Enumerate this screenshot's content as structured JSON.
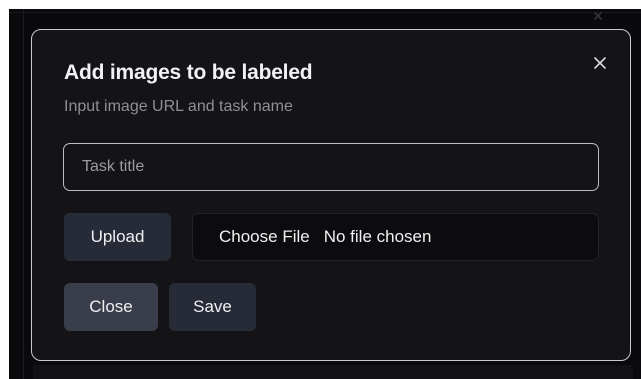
{
  "modal": {
    "title": "Add images to be labeled",
    "subtitle": "Input image URL and task name",
    "task_input": {
      "placeholder": "Task title",
      "value": ""
    },
    "upload_label": "Upload",
    "file_picker": {
      "button_label": "Choose File",
      "status": "No file chosen"
    },
    "close_label": "Close",
    "save_label": "Save",
    "close_icon": "close-icon"
  },
  "background": {
    "close_icon": "close-icon"
  },
  "colors": {
    "overlay_background": "#0a0a0c",
    "modal_background": "#141417",
    "modal_border": "#c9c9cf",
    "title_text": "#f2f2f4",
    "subtitle_text": "#8e8f98",
    "primary_button": "#262b37",
    "secondary_button": "#3a3e4a"
  }
}
